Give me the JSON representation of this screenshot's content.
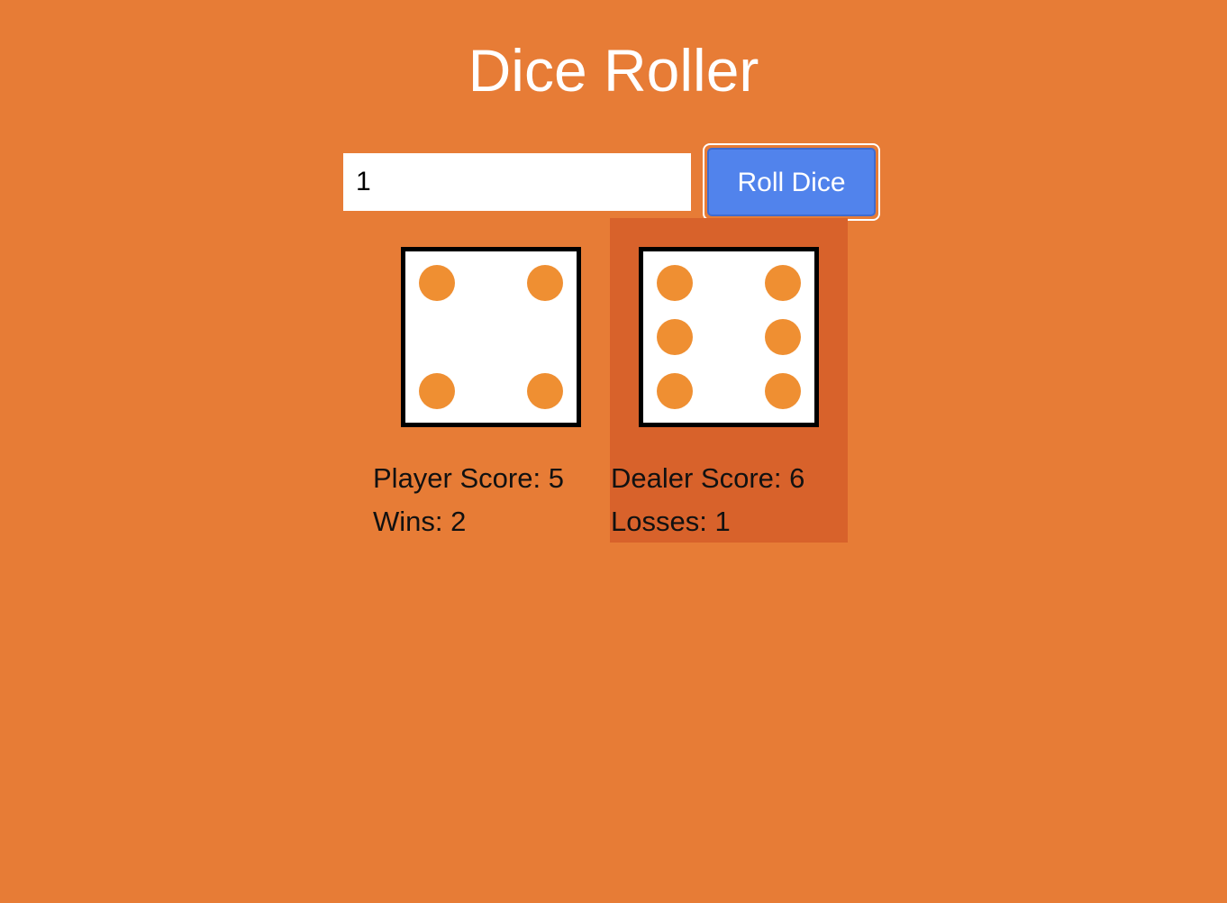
{
  "title": "Dice Roller",
  "controls": {
    "input_value": "1",
    "roll_label": "Roll Dice"
  },
  "player": {
    "die_value": 4,
    "score_text": "Player Score: 5",
    "record_text": "Wins: 2"
  },
  "dealer": {
    "die_value": 6,
    "score_text": "Dealer Score: 6",
    "record_text": "Losses: 1"
  },
  "colors": {
    "background": "#e77c36",
    "dealer_highlight": "#d8622b",
    "pip": "#ef8f32",
    "button": "#5183ec"
  }
}
